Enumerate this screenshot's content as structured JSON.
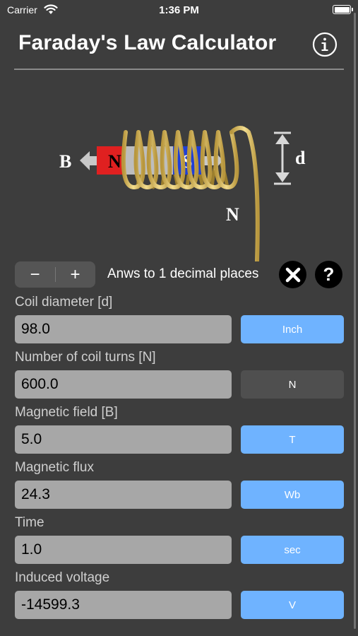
{
  "status": {
    "carrier": "Carrier",
    "time": "1:36 PM"
  },
  "header": {
    "title": "Faraday's Law Calculator",
    "info_icon": "info-circle-icon"
  },
  "diagram": {
    "label_b": "B",
    "label_d": "d",
    "label_n": "N",
    "magnet_n": "N",
    "magnet_s": "S"
  },
  "controls": {
    "minus": "−",
    "plus": "+",
    "precision_text": "Anws to 1 decimal places",
    "clear_icon": "close-x-icon",
    "help_text": "?"
  },
  "fields": [
    {
      "label": "Coil diameter [d]",
      "value": "98.0",
      "unit": "Inch",
      "unit_style": "blue"
    },
    {
      "label": "Number of coil turns [N]",
      "value": "600.0",
      "unit": "N",
      "unit_style": "gray"
    },
    {
      "label": "Magnetic field [B]",
      "value": "5.0",
      "unit": "T",
      "unit_style": "blue"
    },
    {
      "label": "Magnetic flux",
      "value": "24.3",
      "unit": "Wb",
      "unit_style": "blue"
    },
    {
      "label": "Time",
      "value": "1.0",
      "unit": "sec",
      "unit_style": "blue"
    },
    {
      "label": "Induced voltage",
      "value": "-14599.3",
      "unit": "V",
      "unit_style": "blue"
    }
  ],
  "colors": {
    "background": "#3d3d3d",
    "accent": "#6fb3ff",
    "field": "#a7a7a7",
    "coil": "#e0c36a",
    "magnet_north": "#e02020",
    "magnet_south": "#1f3fd6"
  }
}
